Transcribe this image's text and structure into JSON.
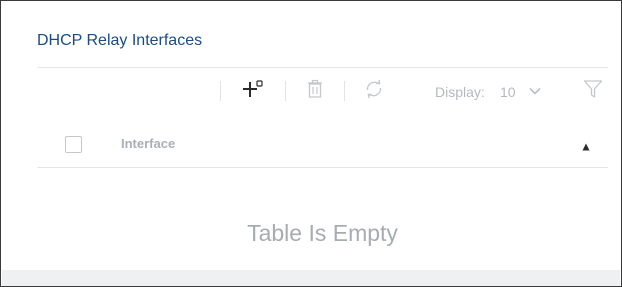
{
  "panel": {
    "title": "DHCP Relay Interfaces"
  },
  "toolbar": {
    "add_icon": "add-icon",
    "delete_icon": "trash-icon",
    "refresh_icon": "refresh-icon",
    "display_label": "Display:",
    "display_value": "10",
    "dropdown_icon": "chevron-down-icon",
    "filter_icon": "filter-icon"
  },
  "table": {
    "columns": [
      "Interface"
    ],
    "sort_icon": "sort-ascending-icon",
    "empty_message": "Table Is Empty"
  },
  "colors": {
    "title": "#1a4c80",
    "toolbar_icon": "#2b2b2b",
    "muted": "#b5b9be"
  }
}
